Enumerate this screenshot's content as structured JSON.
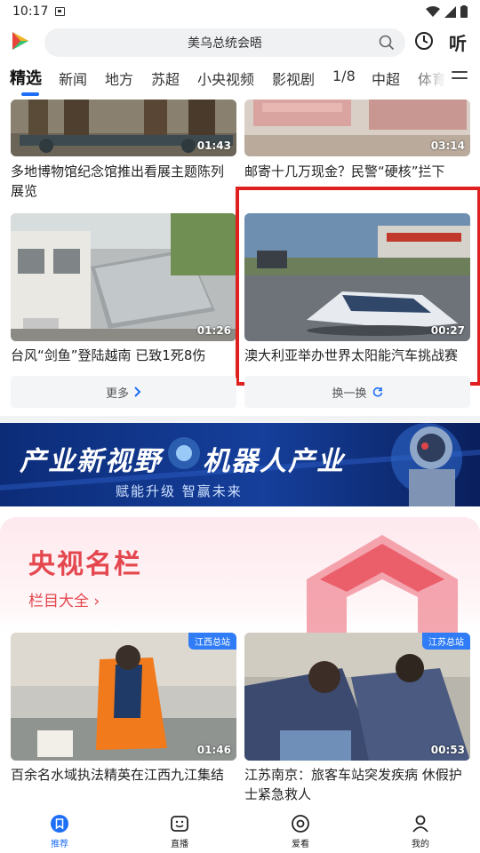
{
  "status_bar": {
    "time": "10:17"
  },
  "header": {
    "search_placeholder": "美乌总统会晤",
    "listen_label": "听"
  },
  "tabs": [
    {
      "label": "精选",
      "active": true
    },
    {
      "label": "新闻"
    },
    {
      "label": "地方"
    },
    {
      "label": "苏超"
    },
    {
      "label": "小央视频"
    },
    {
      "label": "影视剧"
    },
    {
      "label": "1/8"
    },
    {
      "label": "中超"
    },
    {
      "label": "体育"
    }
  ],
  "feed": {
    "cards": [
      {
        "title": "多地博物馆纪念馆推出看展主题陈列展览",
        "duration": "01:43"
      },
      {
        "title": "邮寄十几万现金？民警“硬核”拦下",
        "duration": "03:14"
      },
      {
        "title": "台风“剑鱼”登陆越南 已致1死8伤",
        "duration": "01:26"
      },
      {
        "title": "澳大利亚举办世界太阳能汽车挑战赛",
        "duration": "00:27",
        "highlighted": true
      },
      {
        "title": "百余名水域执法精英在江西九江集结",
        "duration": "01:46",
        "badge": "江西总站"
      },
      {
        "title": "江苏南京：旅客车站突发疾病 休假护士紧急救人",
        "duration": "00:53",
        "badge": "江苏总站"
      }
    ],
    "more_label": "更多",
    "refresh_label": "换一换"
  },
  "banner": {
    "title_left": "产业新视野",
    "title_right": "机器人产业",
    "subtitle": "赋能升级 智赢未来"
  },
  "cctv_section": {
    "title": "央视名栏",
    "link_label": "栏目大全"
  },
  "bottom_nav": [
    {
      "label": "推荐",
      "icon": "bookmark-icon",
      "active": true
    },
    {
      "label": "直播",
      "icon": "tv-face-icon"
    },
    {
      "label": "爱看",
      "icon": "eye-circle-icon"
    },
    {
      "label": "我的",
      "icon": "person-icon"
    }
  ],
  "colors": {
    "accent": "#1e6ff5",
    "highlight": "#e01f1f",
    "cctv_red": "#e4474e"
  }
}
